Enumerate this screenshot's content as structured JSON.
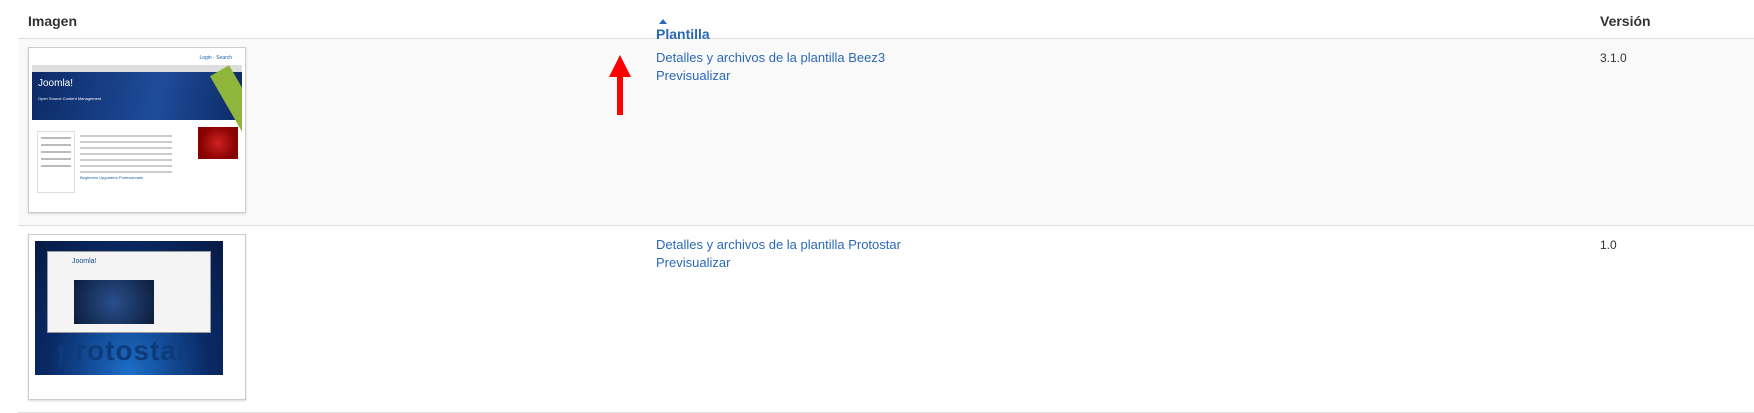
{
  "columns": {
    "image": "Imagen",
    "template": "Plantilla",
    "version": "Versión"
  },
  "rows": [
    {
      "details_link": "Detalles y archivos de la plantilla Beez3",
      "preview_link": "Previsualizar",
      "version": "3.1.0",
      "thumb": {
        "title": "Joomla!",
        "subtitle": "Open Source Content Management",
        "footer_cols": "Beginners   Upgraders   Professionals"
      }
    },
    {
      "details_link": "Detalles y archivos de la plantilla Protostar",
      "preview_link": "Previsualizar",
      "version": "1.0",
      "thumb": {
        "logo": "Joomla!",
        "word": "protostar"
      }
    }
  ],
  "annotation": {
    "color": "#ff0000"
  }
}
